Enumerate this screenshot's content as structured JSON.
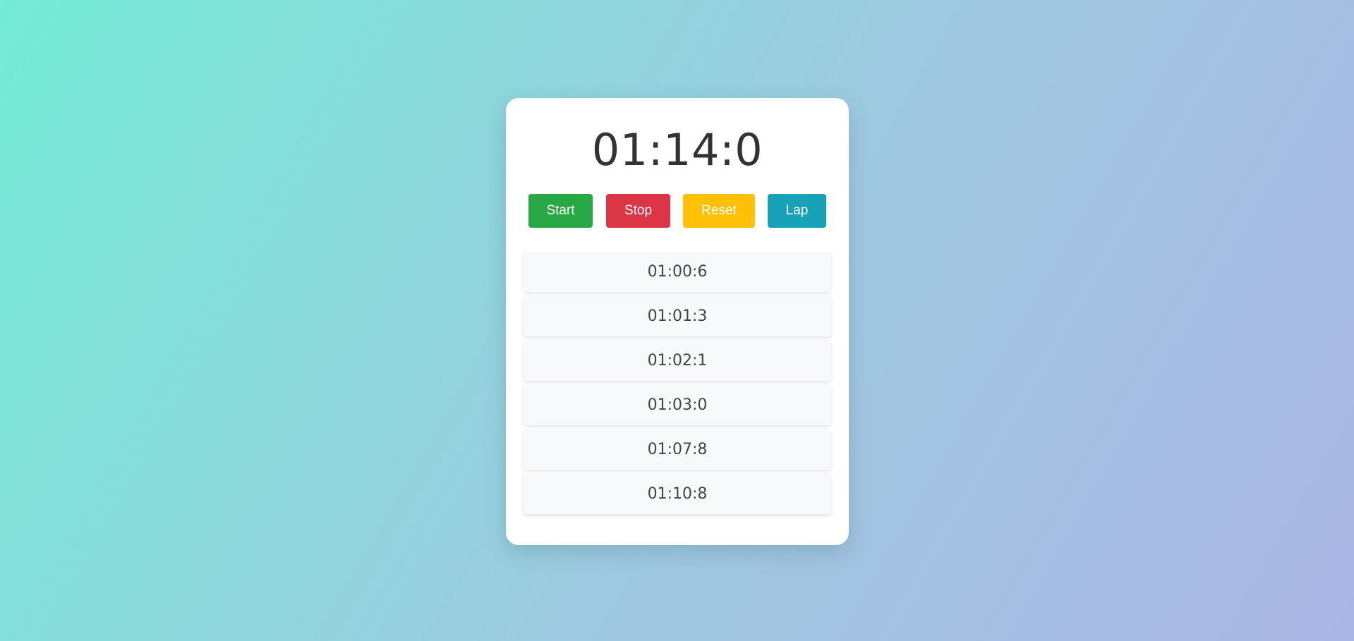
{
  "stopwatch": {
    "time": "01:14:0"
  },
  "controls": {
    "start_label": "Start",
    "stop_label": "Stop",
    "reset_label": "Reset",
    "lap_label": "Lap",
    "colors": {
      "start": "#28a745",
      "stop": "#dc3545",
      "reset": "#ffc107",
      "lap": "#17a2b8"
    }
  },
  "laps": [
    "01:00:6",
    "01:01:3",
    "01:02:1",
    "01:03:0",
    "01:07:8",
    "01:10:8"
  ]
}
